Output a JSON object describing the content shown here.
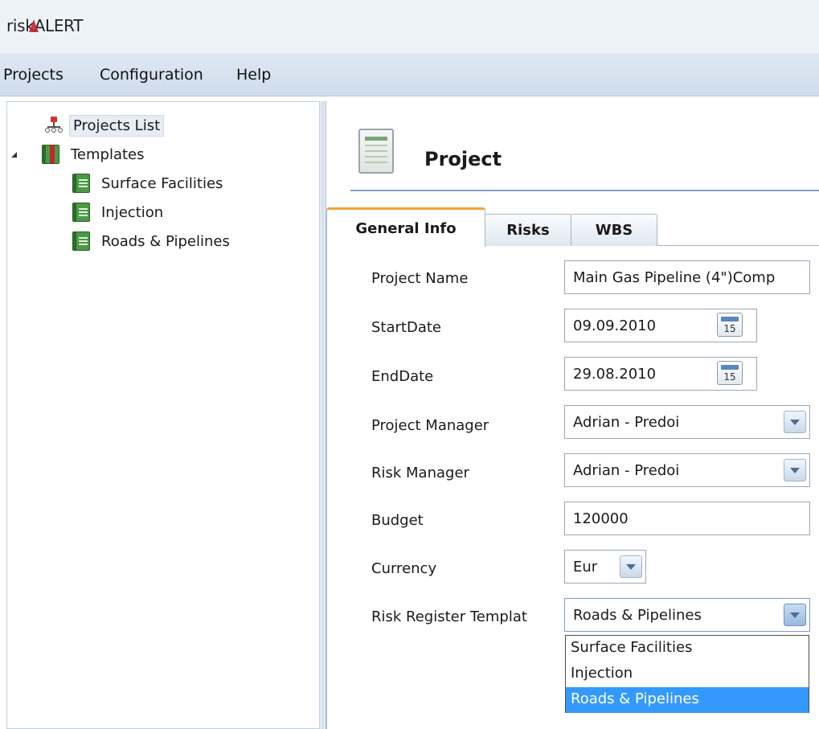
{
  "app": {
    "title_prefix": "risk",
    "title_suffix": "ALERT"
  },
  "menu": [
    "Projects",
    "Configuration",
    "Help"
  ],
  "tree": {
    "projects_list": "Projects List",
    "templates": "Templates",
    "children": [
      "Surface Facilities",
      "Injection",
      "Roads & Pipelines"
    ]
  },
  "page": {
    "title": "Project"
  },
  "tabs": [
    {
      "label": "General Info",
      "active": true
    },
    {
      "label": "Risks",
      "active": false
    },
    {
      "label": "WBS",
      "active": false
    }
  ],
  "form": {
    "project_name": {
      "label": "Project Name",
      "value": "Main Gas Pipeline (4\")Comp"
    },
    "start_date": {
      "label": "StartDate",
      "value": "09.09.2010",
      "cal": "15"
    },
    "end_date": {
      "label": "EndDate",
      "value": "29.08.2010",
      "cal": "15"
    },
    "project_manager": {
      "label": "Project Manager",
      "value": "Adrian - Predoi"
    },
    "risk_manager": {
      "label": "Risk Manager",
      "value": "Adrian - Predoi"
    },
    "budget": {
      "label": "Budget",
      "value": "120000"
    },
    "currency": {
      "label": "Currency",
      "value": "Eur"
    },
    "risk_register_template": {
      "label": "Risk Register Templat",
      "value": "Roads & Pipelines",
      "options": [
        "Surface Facilities",
        "Injection",
        "Roads & Pipelines"
      ],
      "selected_index": 2
    }
  },
  "colors": {
    "accent": "#f2a33a",
    "selection": "#3399ff",
    "brand_mark": "#c0282d"
  }
}
